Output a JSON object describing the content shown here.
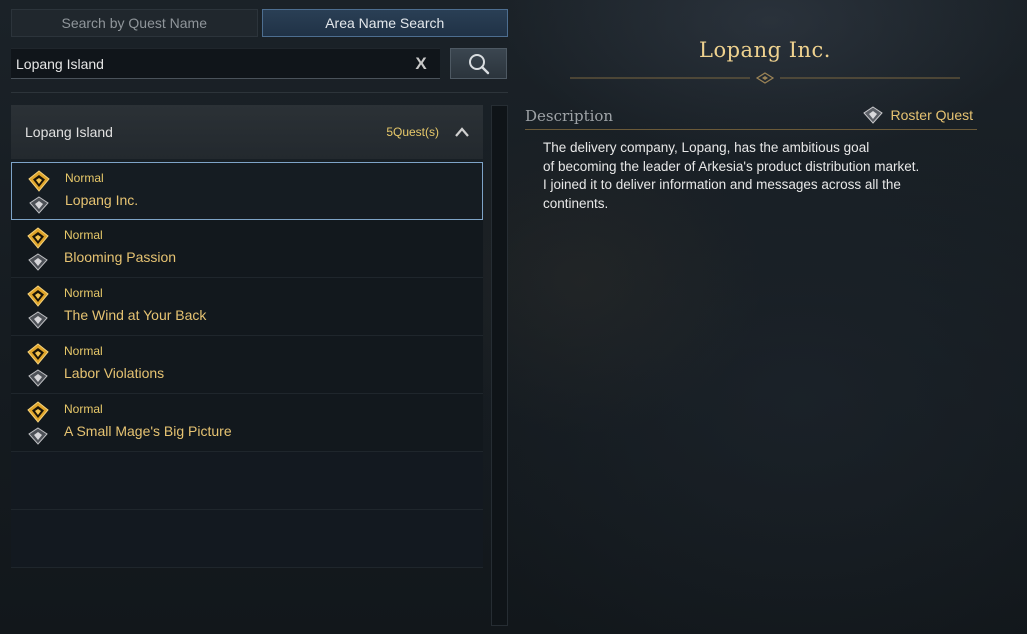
{
  "tabs": [
    {
      "label": "Search by Quest Name",
      "active": false
    },
    {
      "label": "Area Name Search",
      "active": true
    }
  ],
  "search": {
    "value": "Lopang Island",
    "clear_glyph": "X",
    "search_icon": "magnifier-icon"
  },
  "area": {
    "name": "Lopang Island",
    "count": "5Quest(s)",
    "collapse_icon": "chevron-up-icon"
  },
  "quests": [
    {
      "type": "Normal",
      "name": "Lopang Inc.",
      "selected": true
    },
    {
      "type": "Normal",
      "name": "Blooming Passion",
      "selected": false
    },
    {
      "type": "Normal",
      "name": "The Wind at Your Back",
      "selected": false
    },
    {
      "type": "Normal",
      "name": "Labor Violations",
      "selected": false
    },
    {
      "type": "Normal",
      "name": "A Small Mage's Big Picture",
      "selected": false
    }
  ],
  "detail": {
    "title": "Lopang Inc.",
    "description_label": "Description",
    "roster_label": "Roster Quest",
    "description_lines": [
      "The delivery company, Lopang, has the ambitious goal",
      "of becoming the leader of Arkesia's product distribution market.",
      "I joined it to deliver information and messages across all the",
      "continents."
    ]
  },
  "colors": {
    "accent_gold": "#e6c372",
    "active_tab_border": "#4d6e90",
    "selected_row_border": "#7ea4c8"
  }
}
